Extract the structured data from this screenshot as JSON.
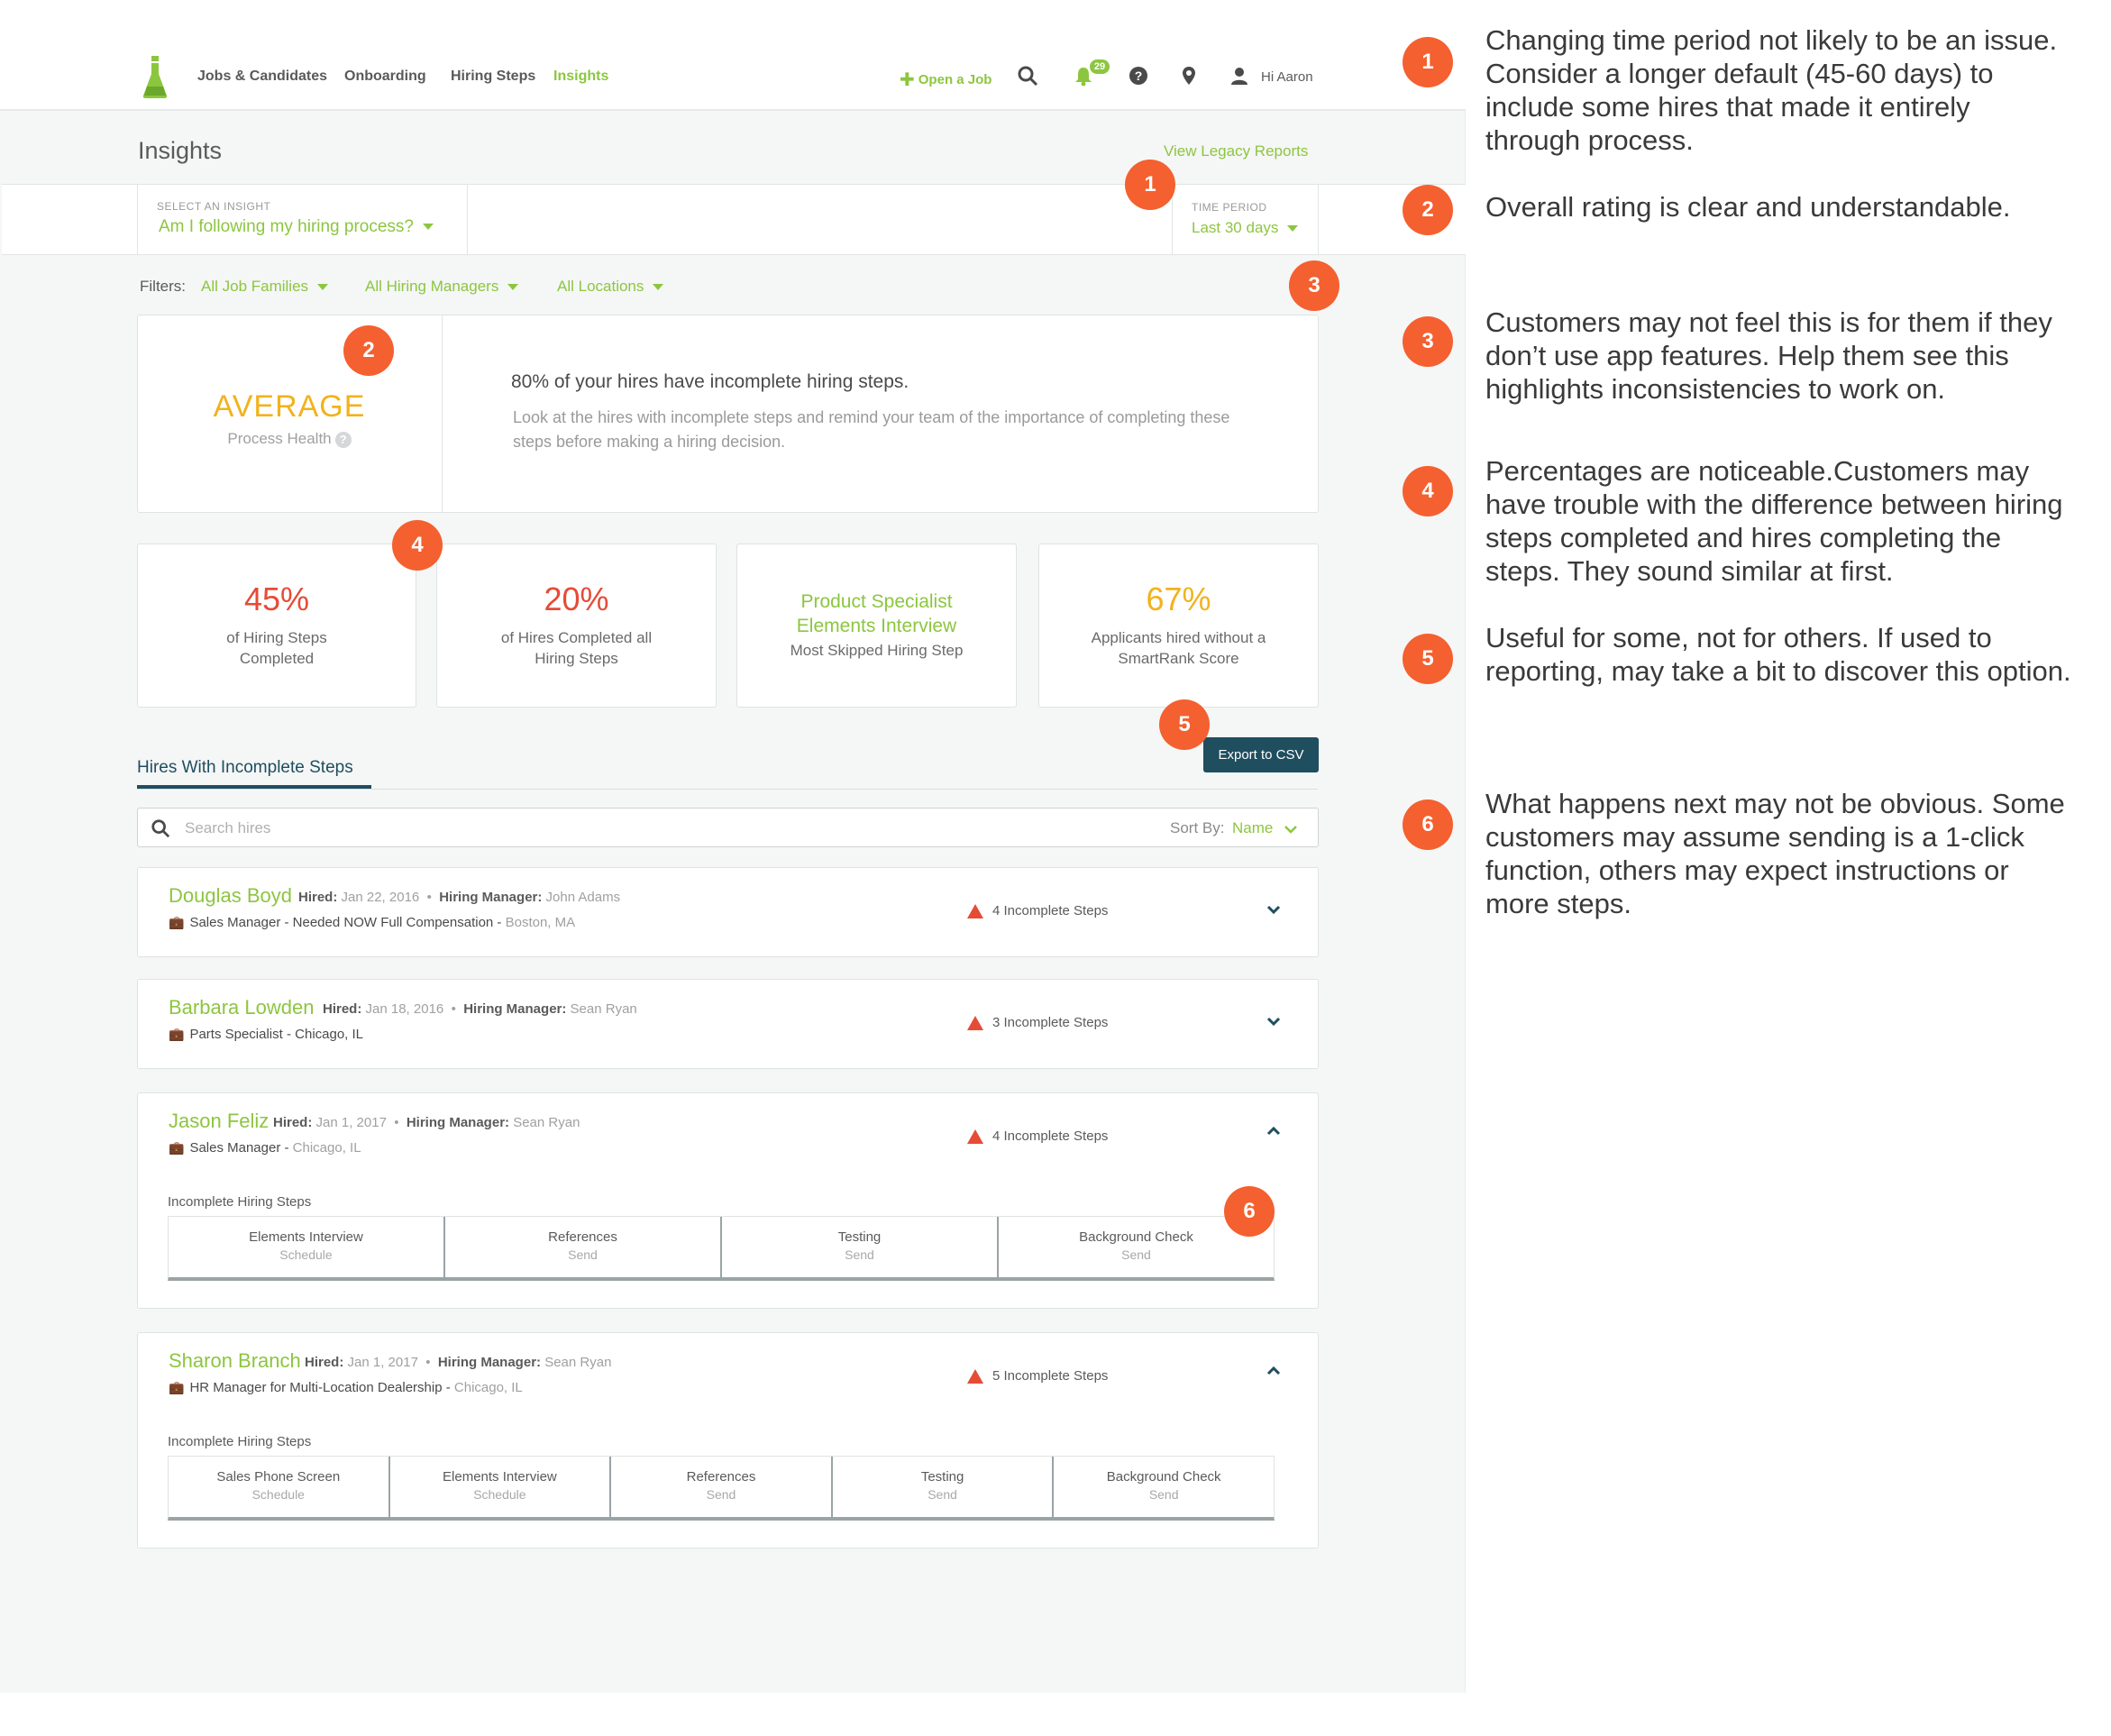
{
  "nav": {
    "items": [
      {
        "label": "Jobs & Candidates"
      },
      {
        "label": "Onboarding"
      },
      {
        "label": "Hiring Steps"
      },
      {
        "label": "Insights"
      }
    ],
    "open_job": "Open a Job",
    "notification_count": "29",
    "greeting": "Hi Aaron"
  },
  "page": {
    "title": "Insights",
    "legacy_link": "View Legacy Reports"
  },
  "insight_bar": {
    "select_label": "SELECT AN INSIGHT",
    "select_value": "Am I following my hiring process?",
    "period_label": "TIME PERIOD",
    "period_value": "Last 30 days"
  },
  "filters": {
    "label": "Filters:",
    "items": [
      "All Job Families",
      "All Hiring Managers",
      "All Locations"
    ]
  },
  "health": {
    "rating": "AVERAGE",
    "label": "Process Health",
    "headline": "80% of your hires have incomplete hiring steps.",
    "body": "Look at the hires with incomplete steps and remind your team of the importance of completing these steps before making a hiring decision."
  },
  "stats": [
    {
      "value": "45%",
      "label": "of Hiring Steps Completed",
      "color": "#e64b36"
    },
    {
      "value": "20%",
      "label": "of Hires Completed all Hiring Steps",
      "color": "#e64b36"
    },
    {
      "value": "Product Specialist Elements Interview",
      "label": "Most Skipped Hiring Step",
      "color": "#8cc63f"
    },
    {
      "value": "67%",
      "label": "Applicants hired without a SmartRank Score",
      "color": "#f2b21b"
    }
  ],
  "export_label": "Export to CSV",
  "tab_label": "Hires With Incomplete Steps",
  "search": {
    "placeholder": "Search hires",
    "sort_label": "Sort By:",
    "sort_value": "Name"
  },
  "labels": {
    "hired": "Hired:",
    "manager": "Hiring Manager:",
    "incomplete_steps": "Incomplete Hiring Steps"
  },
  "hires": [
    {
      "name": "Douglas Boyd",
      "hired": "Jan 22, 2016",
      "manager": "John Adams",
      "job": "Sales Manager - Needed NOW Full Compensation - ",
      "location": "Boston, MA",
      "incomplete": "4 Incomplete Steps",
      "expanded": false,
      "steps": []
    },
    {
      "name": "Barbara Lowden",
      "hired": "Jan 18, 2016",
      "manager": "Sean Ryan",
      "job": "Parts Specialist - Chicago, IL",
      "location": "",
      "incomplete": "3 Incomplete Steps",
      "expanded": false,
      "steps": []
    },
    {
      "name": "Jason Feliz",
      "hired": "Jan 1, 2017",
      "manager": "Sean Ryan",
      "job": "Sales Manager - ",
      "location": "Chicago, IL",
      "incomplete": "4 Incomplete Steps",
      "expanded": true,
      "steps": [
        {
          "name": "Elements Interview",
          "action": "Schedule"
        },
        {
          "name": "References",
          "action": "Send"
        },
        {
          "name": "Testing",
          "action": "Send"
        },
        {
          "name": "Background Check",
          "action": "Send"
        }
      ]
    },
    {
      "name": "Sharon Branch",
      "hired": "Jan 1, 2017",
      "manager": "Sean Ryan",
      "job": "HR Manager for Multi-Location Dealership - ",
      "location": "Chicago, IL",
      "incomplete": "5 Incomplete Steps",
      "expanded": true,
      "steps": [
        {
          "name": "Sales Phone Screen",
          "action": "Schedule"
        },
        {
          "name": "Elements Interview",
          "action": "Schedule"
        },
        {
          "name": "References",
          "action": "Send"
        },
        {
          "name": "Testing",
          "action": "Send"
        },
        {
          "name": "Background Check",
          "action": "Send"
        }
      ]
    }
  ],
  "markers": [
    "1",
    "2",
    "3",
    "4",
    "5",
    "6"
  ],
  "notes": [
    {
      "num": "1",
      "text": "Changing time period not likely to be an issue. Consider a longer default (45-60 days) to include some hires that made it entirely through process."
    },
    {
      "num": "2",
      "text": "Overall rating is clear and understandable."
    },
    {
      "num": "3",
      "text": "Customers may not feel this is for them if they don’t use app features. Help them see this highlights inconsistencies to work on."
    },
    {
      "num": "4",
      "text": "Percentages are noticeable.Customers may have trouble with the difference between hiring steps completed and hires completing the steps. They sound similar at first."
    },
    {
      "num": "5",
      "text": "Useful for some, not for others. If used to reporting, may take a bit to discover this option."
    },
    {
      "num": "6",
      "text": "What happens next may not be obvious. Some customers may assume sending is a 1-click function, others may expect instructions or more steps."
    }
  ],
  "colors": {
    "brand": "#8cc63f",
    "accent": "#1f4e5f",
    "marker": "#f4602f",
    "warning": "#e64b36",
    "rating": "#f2b21b"
  }
}
